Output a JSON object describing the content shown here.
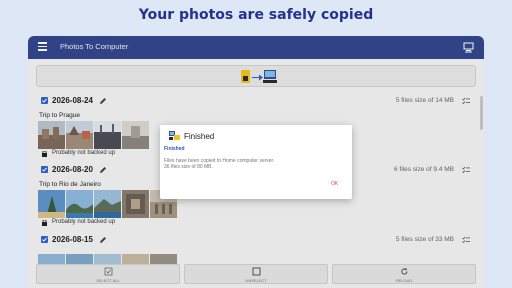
{
  "headline": "Your photos are safely copied",
  "appbar": {
    "title": "Photos To Computer"
  },
  "groups": [
    {
      "date": "2026-08-24",
      "place": "Trip to Prague",
      "size": "5 files size of 14 MB",
      "backup": "Probably not backed up"
    },
    {
      "date": "2026-08-20",
      "place": "Trip to Rio de Janeiro",
      "size": "6 files size of 9.4 MB",
      "backup": "Probably not backed up"
    },
    {
      "date": "2026-08-15",
      "place": "",
      "size": "5 files size of 33 MB",
      "backup": ""
    }
  ],
  "bottom": {
    "btn1": "SELECT ALL",
    "btn2": "UNSELECT",
    "btn3": "RELOAD"
  },
  "dialog": {
    "title": "Finished",
    "subtitle": "Finished",
    "message_line1": "Files have been copied to Home computer server.",
    "message_line2": "36 files size of 80 MB.",
    "ok": "OK"
  },
  "colors": {
    "appbar": "#34468d",
    "accent": "#2f62c6",
    "background": "#dde7f6",
    "ok": "#e33b3b"
  }
}
